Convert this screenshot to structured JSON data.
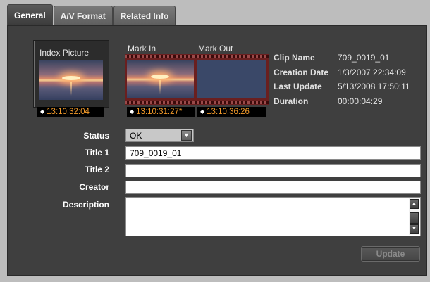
{
  "tabs": [
    {
      "label": "General",
      "active": true
    },
    {
      "label": "A/V Format",
      "active": false
    },
    {
      "label": "Related Info",
      "active": false
    }
  ],
  "index_picture": {
    "label": "Index Picture",
    "timecode": "13:10:32:04"
  },
  "mark_in": {
    "label": "Mark In",
    "timecode": "13:10:31:27*"
  },
  "mark_out": {
    "label": "Mark Out",
    "timecode": "13:10:36:26"
  },
  "info": {
    "clip_name_key": "Clip Name",
    "clip_name": "709_0019_01",
    "creation_date_key": "Creation Date",
    "creation_date": "1/3/2007 22:34:09",
    "last_update_key": "Last Update",
    "last_update": "5/13/2008 17:50:11",
    "duration_key": "Duration",
    "duration": "00:00:04:29"
  },
  "form": {
    "status_label": "Status",
    "status_value": "OK",
    "title1_label": "Title 1",
    "title1_value": "709_0019_01",
    "title2_label": "Title 2",
    "title2_value": "",
    "creator_label": "Creator",
    "creator_value": "",
    "description_label": "Description",
    "description_value": ""
  },
  "update_button": "Update",
  "colors": {
    "panel": "#3f3f3f",
    "timecode": "#f29a2a",
    "film": "#6a1f1f"
  }
}
